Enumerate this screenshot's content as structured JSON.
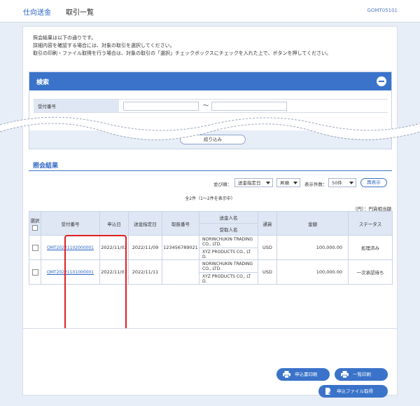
{
  "header": {
    "breadcrumb_parent": "仕向送金",
    "breadcrumb_current": "取引一覧",
    "screen_id": "GOMT05101"
  },
  "intro": {
    "line1": "照会結果は以下の通りです。",
    "line2": "詳細内容を確認する場合には、対象の取引を選択してください。",
    "line3": "取引の印刷・ファイル取得を行う場合は、対象の取引の「選択」チェックボックスにチェックを入れた上で、ボタンを押してください。"
  },
  "search": {
    "title": "検索",
    "field_label": "受付番号",
    "range_separator": "～",
    "submit_label": "絞り込み"
  },
  "results": {
    "title": "照会結果",
    "sort_label": "並び順：",
    "sort_key": "送金指定日",
    "sort_order": "昇順",
    "per_page_label": "表示件数：",
    "per_page": "50件",
    "redisplay_label": "再表示",
    "count_text": "全2件（1～2件を表示中）",
    "unit_text": "（円）：円貨相当額",
    "headers": {
      "select": "選択",
      "reception_no": "受付番号",
      "apply_date": "申込日",
      "remit_date": "送金指定日",
      "handling_no": "取扱番号",
      "remitter": "送金人名",
      "beneficiary": "受取人名",
      "currency": "通貨",
      "amount": "金額",
      "status": "ステータス"
    },
    "rows": [
      {
        "reception_no": "OMT20221102000001",
        "apply_date": "2022/11/02",
        "remit_date": "2022/11/09",
        "handling_no": "123456789021",
        "remitter": "NORINCHUKIN TRADING CO., LTD.",
        "beneficiary": "XYZ PRODUCTS CO., LT D.",
        "currency": "USD",
        "amount": "100,000.00",
        "status": "処理済み"
      },
      {
        "reception_no": "OMT20221101000001",
        "apply_date": "2022/11/01",
        "remit_date": "2022/11/11",
        "handling_no": "",
        "remitter": "NORINCHUKIN TRADING CO., LTD.",
        "beneficiary": "XYZ PRODUCTS CO., LT D.",
        "currency": "USD",
        "amount": "100,000.00",
        "status": "一次承認待ち"
      }
    ]
  },
  "buttons": {
    "print_application": "申込書印刷",
    "print_list": "一覧印刷",
    "get_file": "申込ファイル取得"
  },
  "colors": {
    "accent": "#3a73c9",
    "header_cell": "#dfe7f4",
    "highlight": "#e02020",
    "background": "#e8eef7"
  }
}
